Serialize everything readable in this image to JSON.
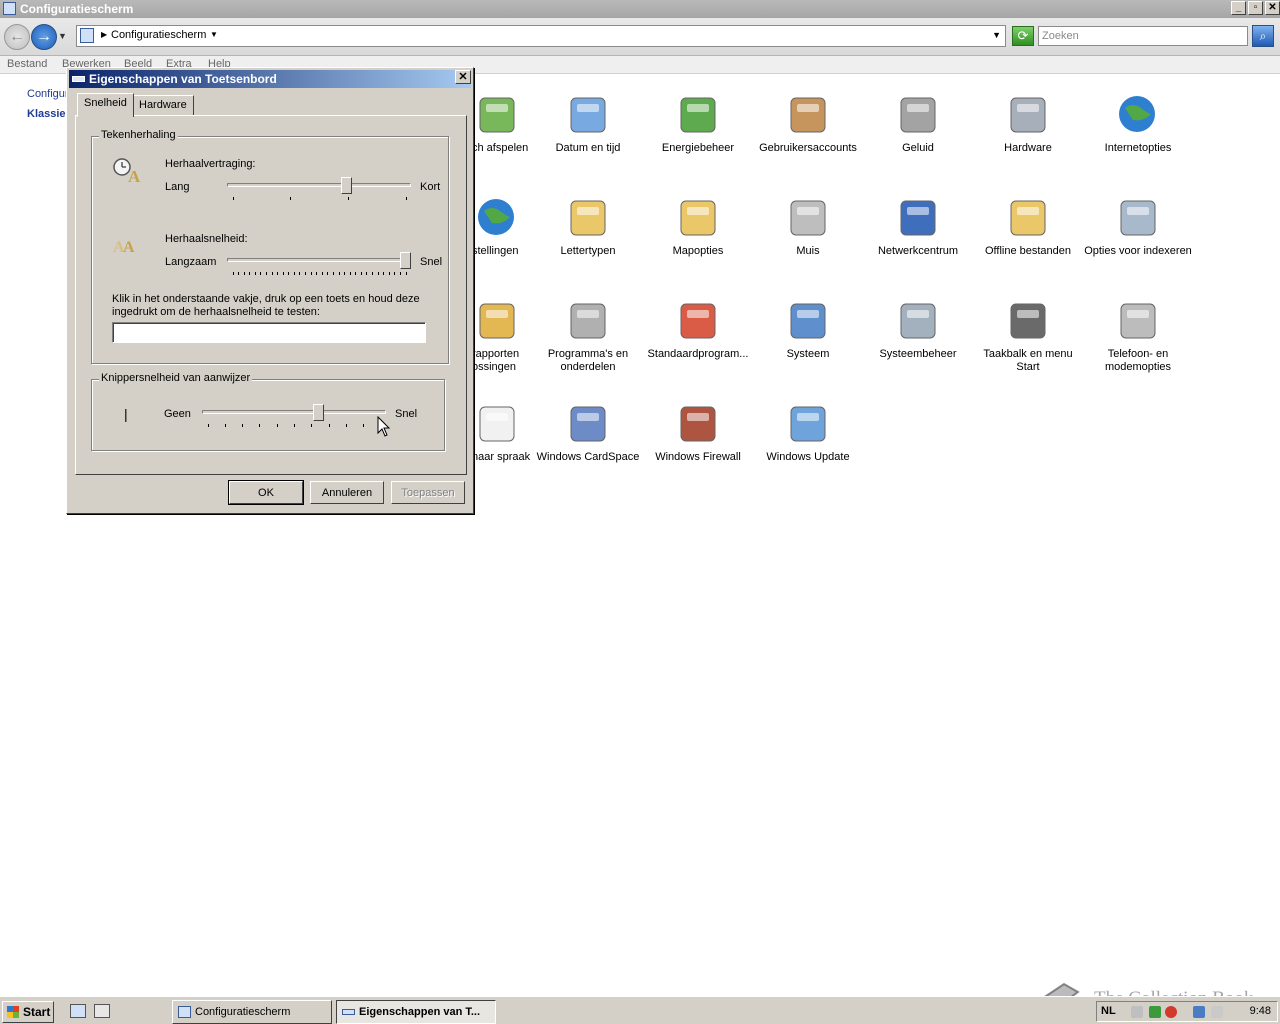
{
  "explorer": {
    "title": "Configuratiescherm",
    "address": "Configuratiescherm",
    "search_placeholder": "Zoeken",
    "menu": [
      "Bestand",
      "Bewerken",
      "Beeld",
      "Extra",
      "Help"
    ],
    "left_links": [
      "Configur",
      "Klassie"
    ],
    "items": [
      {
        "label": "ch afspelen",
        "icon": "autoplay-icon"
      },
      {
        "label": "Datum en tijd",
        "icon": "calendar-clock-icon"
      },
      {
        "label": "Energiebeheer",
        "icon": "battery-plug-icon"
      },
      {
        "label": "Gebruikersaccounts",
        "icon": "users-icon"
      },
      {
        "label": "Geluid",
        "icon": "speaker-icon"
      },
      {
        "label": "Hardware",
        "icon": "hardware-icon"
      },
      {
        "label": "Internetopties",
        "icon": "globe-icon"
      },
      {
        "label": "stellingen",
        "icon": "globe-icon"
      },
      {
        "label": "Lettertypen",
        "icon": "font-folder-icon"
      },
      {
        "label": "Mapopties",
        "icon": "folder-options-icon"
      },
      {
        "label": "Muis",
        "icon": "mouse-icon"
      },
      {
        "label": "Netwerkcentrum",
        "icon": "network-icon"
      },
      {
        "label": "Offline bestanden",
        "icon": "offline-folder-icon"
      },
      {
        "label": "Opties voor indexeren",
        "icon": "indexing-icon"
      },
      {
        "label": "rapporten ossingen",
        "icon": "problem-reports-icon"
      },
      {
        "label": "Programma's en onderdelen",
        "icon": "programs-icon"
      },
      {
        "label": "Standaardprogram...",
        "icon": "default-programs-icon"
      },
      {
        "label": "Systeem",
        "icon": "system-icon"
      },
      {
        "label": "Systeembeheer",
        "icon": "admin-tools-icon"
      },
      {
        "label": "Taakbalk en menu Start",
        "icon": "taskbar-icon"
      },
      {
        "label": "Telefoon- en modemopties",
        "icon": "phone-icon"
      },
      {
        "label": "naar spraak",
        "icon": "speech-icon"
      },
      {
        "label": "Windows CardSpace",
        "icon": "cardspace-icon"
      },
      {
        "label": "Windows Firewall",
        "icon": "firewall-icon"
      },
      {
        "label": "Windows Update",
        "icon": "windows-update-icon"
      }
    ]
  },
  "dialog": {
    "title": "Eigenschappen van Toetsenbord",
    "close_label": "✕",
    "tabs": [
      "Snelheid",
      "Hardware"
    ],
    "group_repeat": "Tekenherhaling",
    "repeat_delay_label": "Herhaalvertraging:",
    "repeat_delay_min": "Lang",
    "repeat_delay_max": "Kort",
    "repeat_delay_value": 0.66,
    "repeat_rate_label": "Herhaalsnelheid:",
    "repeat_rate_min": "Langzaam",
    "repeat_rate_max": "Snel",
    "repeat_rate_value": 1.0,
    "test_instruction": "Klik in het onderstaande vakje, druk op een toets en houd deze ingedrukt om de herhaalsnelheid te testen:",
    "test_value": "",
    "group_blink": "Knippersnelheid van aanwijzer",
    "blink_cursor_glyph": "|",
    "blink_min": "Geen",
    "blink_max": "Snel",
    "blink_value": 0.64,
    "ok": "OK",
    "cancel": "Annuleren",
    "apply": "Toepassen"
  },
  "taskbar": {
    "start": "Start",
    "tasks": [
      "Configuratiescherm",
      "Eigenschappen van T..."
    ],
    "lang": "NL",
    "time": "9:48"
  },
  "watermark": "The Collection Book"
}
